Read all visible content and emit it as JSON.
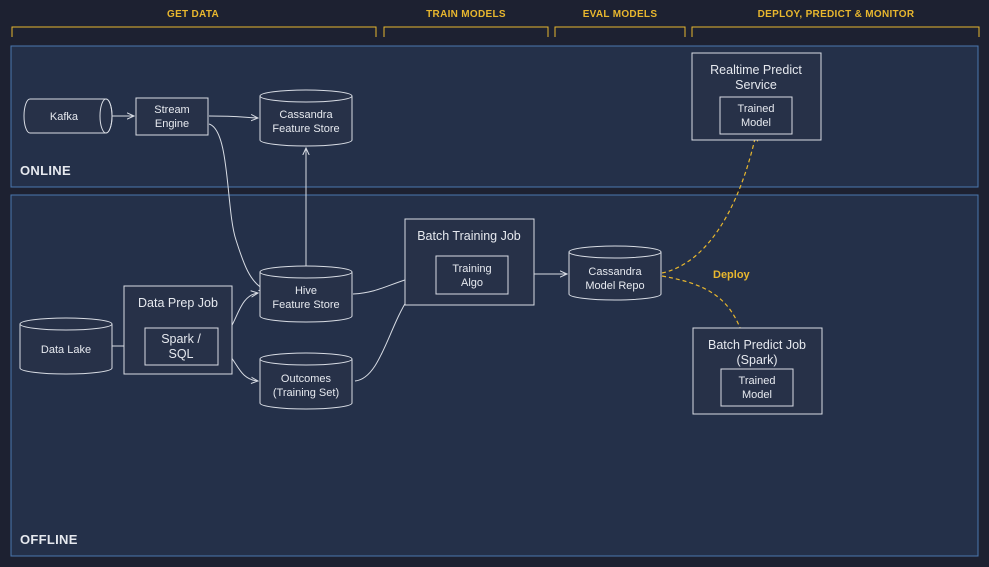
{
  "colors": {
    "background": "#1d2131",
    "zone_fill": "#243049",
    "zone_border": "#4a78b0",
    "stage_accent": "#e8b72e",
    "line": "#d8dce4",
    "deploy_line": "#e8b72e"
  },
  "stages": [
    {
      "label": "GET DATA"
    },
    {
      "label": "TRAIN MODELS"
    },
    {
      "label": "EVAL MODELS"
    },
    {
      "label": "DEPLOY, PREDICT & MONITOR"
    }
  ],
  "zones": {
    "online": "ONLINE",
    "offline": "OFFLINE"
  },
  "nodes": {
    "kafka": "Kafka",
    "stream_engine": [
      "Stream",
      "Engine"
    ],
    "cassandra_feature_store": [
      "Cassandra",
      "Feature Store"
    ],
    "realtime_predict_service": [
      "Realtime Predict",
      "Service"
    ],
    "realtime_trained_model": [
      "Trained",
      "Model"
    ],
    "data_lake": "Data Lake",
    "data_prep_job": "Data Prep Job",
    "spark_sql": [
      "Spark /",
      "SQL"
    ],
    "hive_feature_store": [
      "Hive",
      "Feature Store"
    ],
    "outcomes": [
      "Outcomes",
      "(Training Set)"
    ],
    "batch_training_job": "Batch Training Job",
    "training_algo": [
      "Training",
      "Algo"
    ],
    "cassandra_model_repo": [
      "Cassandra",
      "Model Repo"
    ],
    "batch_predict_job": [
      "Batch Predict Job",
      "(Spark)"
    ],
    "batch_trained_model": [
      "Trained",
      "Model"
    ]
  },
  "deploy_label": "Deploy"
}
